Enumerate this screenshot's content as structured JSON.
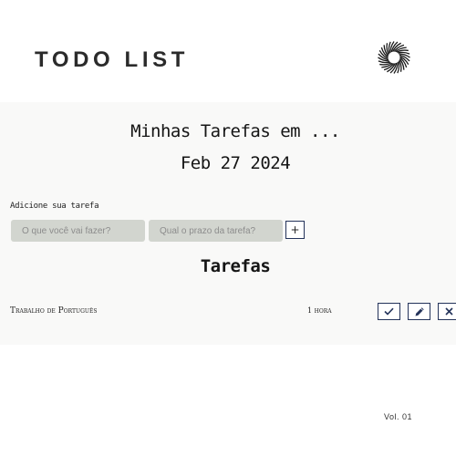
{
  "brand": {
    "title": "TODO LIST"
  },
  "header": {
    "line1": "Minhas Tarefas em ...",
    "line2": "Feb 27 2024"
  },
  "form": {
    "label": "Adicione sua tarefa",
    "task_placeholder": "O que você vai fazer?",
    "deadline_placeholder": "Qual o prazo da tarefa?",
    "add_label": "+"
  },
  "tasks_section": {
    "title": "Tarefas"
  },
  "tasks": [
    {
      "name": "Trabalho de Português",
      "deadline": "1 hora",
      "actions": [
        "check-icon",
        "pencil-icon",
        "close-icon"
      ]
    }
  ],
  "footer": {
    "volume": "Vol. 01"
  },
  "colors": {
    "accent": "#24335a",
    "input_bg": "#d2d5cf",
    "panel_bg": "#f9f9f8"
  }
}
